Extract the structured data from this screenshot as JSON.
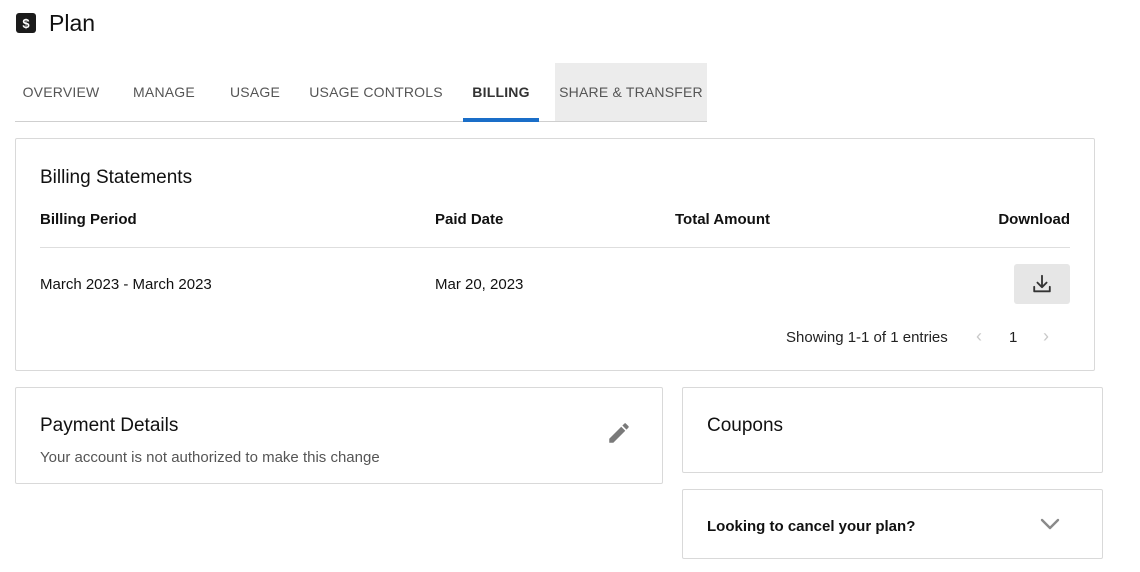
{
  "header": {
    "icon": "dollar-badge-icon",
    "icon_glyph": "$",
    "title": "Plan"
  },
  "tabs": [
    {
      "label": "OVERVIEW",
      "active": false
    },
    {
      "label": "MANAGE",
      "active": false
    },
    {
      "label": "USAGE",
      "active": false
    },
    {
      "label": "USAGE CONTROLS",
      "active": false
    },
    {
      "label": "BILLING",
      "active": true
    },
    {
      "label": "SHARE & TRANSFER",
      "active": false
    }
  ],
  "billing": {
    "title": "Billing Statements",
    "columns": [
      "Billing Period",
      "Paid Date",
      "Total Amount",
      "Download"
    ],
    "rows": [
      {
        "period": "March 2023 - March 2023",
        "paid_date": "Mar 20, 2023",
        "total": "",
        "download_icon": "download-icon"
      }
    ],
    "pager": {
      "summary": "Showing 1-1 of 1 entries",
      "prev": "‹",
      "page": "1",
      "next": "›"
    }
  },
  "payment": {
    "title": "Payment Details",
    "note": "Your account is not authorized to make this change",
    "edit_icon": "pencil-icon"
  },
  "coupons": {
    "title": "Coupons"
  },
  "cancel": {
    "label": "Looking to cancel your plan?",
    "icon": "chevron-down-icon"
  },
  "colors": {
    "accent": "#1a6ec8",
    "tab_hover_bg": "#ececec",
    "button_bg": "#e6e6e6",
    "border": "#d9d9d9"
  }
}
